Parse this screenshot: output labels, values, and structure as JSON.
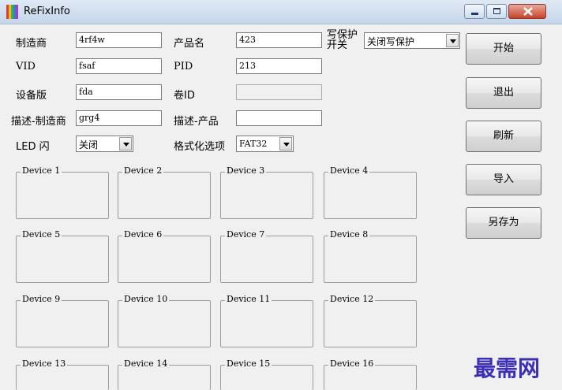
{
  "window": {
    "title": "ReFixInfo"
  },
  "form": {
    "manufacturer_label": "制造商",
    "manufacturer_value": "4rf4w",
    "product_name_label": "产品名",
    "product_name_value": "423",
    "write_protect_label_1": "写保护",
    "write_protect_label_2": "开关",
    "write_protect_value": "关闭写保护",
    "vid_label": "VID",
    "vid_value": "fsaf",
    "pid_label": "PID",
    "pid_value": "213",
    "device_version_label": "设备版",
    "device_version_value": "fda",
    "volume_id_label": "卷ID",
    "volume_id_value": "",
    "desc_manufacturer_label": "描述-制造商",
    "desc_manufacturer_value": "grg4",
    "desc_product_label": "描述-产品",
    "desc_product_value": "",
    "led_label": "LED 闪",
    "led_value": "关闭",
    "format_label": "格式化选项",
    "format_value": "FAT32"
  },
  "buttons": {
    "start": "开始",
    "exit": "退出",
    "refresh": "刷新",
    "import": "导入",
    "save_as": "另存为"
  },
  "devices": [
    "Device 1",
    "Device 2",
    "Device 3",
    "Device 4",
    "Device 5",
    "Device 6",
    "Device 7",
    "Device 8",
    "Device 9",
    "Device 10",
    "Device 11",
    "Device 12",
    "Device 13",
    "Device 14",
    "Device 15",
    "Device 16"
  ],
  "watermark": "最需网",
  "colors": {
    "icon_stripes": [
      "#e23b3b",
      "#f0c020",
      "#3bb34a",
      "#3a78d8",
      "#a040c0"
    ],
    "watermark": "#3a2fb5"
  }
}
